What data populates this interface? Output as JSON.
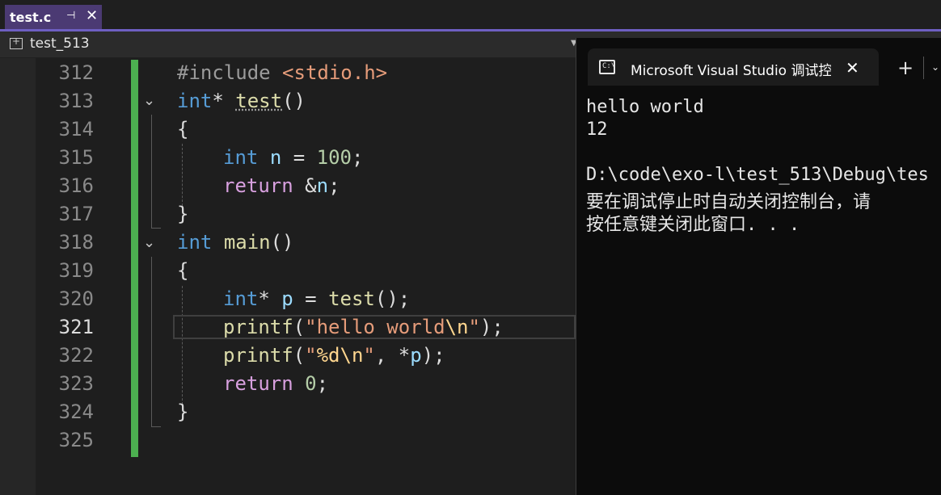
{
  "tab": {
    "title": "test.c",
    "pin": "⊣",
    "close": "✕"
  },
  "nav": {
    "project": "test_513"
  },
  "editor": {
    "line_numbers": [
      "312",
      "313",
      "314",
      "315",
      "316",
      "317",
      "318",
      "319",
      "320",
      "321",
      "322",
      "323",
      "324",
      "325"
    ],
    "current_line": "321",
    "lines": {
      "l312": {
        "directive": "#include",
        "header": "<stdio.h>"
      },
      "l313": {
        "type": "int",
        "ptr": "*",
        "name": "test",
        "paren": "()"
      },
      "l314": "{",
      "l315": {
        "type": "int",
        "var": "n",
        "assign": " = ",
        "value": "100",
        "semi": ";"
      },
      "l316": {
        "ret": "return",
        "amp": " &",
        "var": "n",
        "semi": ";"
      },
      "l317": "}",
      "l318": {
        "type": "int",
        "name": "main",
        "paren": "()"
      },
      "l319": "{",
      "l320": {
        "type": "int",
        "ptr": "*",
        "var": "p",
        "assign": " = ",
        "call": "test",
        "rest": "();"
      },
      "l321": {
        "fn": "printf",
        "open": "(",
        "str1": "\"hello world",
        "esc": "\\n",
        "str2": "\"",
        "close": ");"
      },
      "l322": {
        "fn": "printf",
        "open": "(",
        "str1": "\"",
        "fmt": "%d",
        "esc": "\\n",
        "str2": "\"",
        "mid": ", *",
        "var": "p",
        "close": ");"
      },
      "l323": {
        "ret": "return",
        "space": " ",
        "value": "0",
        "semi": ";"
      },
      "l324": "}"
    }
  },
  "console": {
    "title": "Microsoft Visual Studio 调试控",
    "icon_text": "C:\\",
    "plus": "+",
    "close": "✕",
    "lines": [
      "hello world",
      "12",
      "",
      "D:\\code\\exo-l\\test_513\\Debug\\tes",
      "要在调试停止时自动关闭控制台，请",
      "按任意键关闭此窗口. . ."
    ]
  }
}
